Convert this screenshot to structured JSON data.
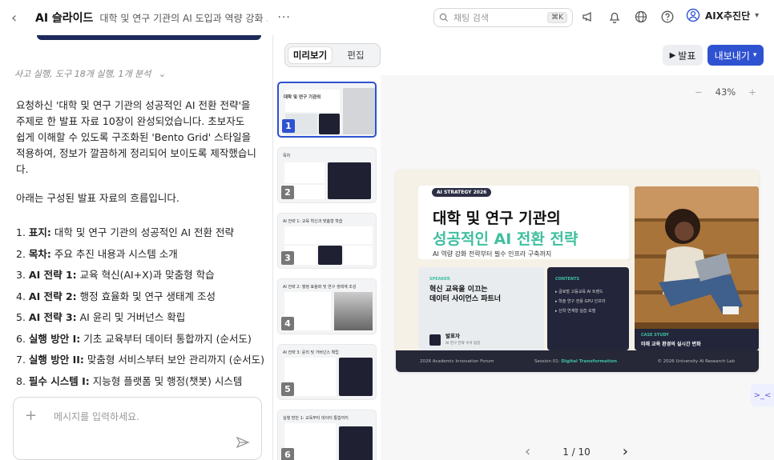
{
  "header": {
    "app_title": "AI 슬라이드",
    "doc_title": "대학 및 연구 기관의 AI 도입과 역량 강화 ...",
    "search_placeholder": "채팅 검색",
    "search_shortcut": "⌘K",
    "user_name": "AIX추진단"
  },
  "chat": {
    "thought_summary": "사고 실행, 도구 18개 실행, 1개 분석",
    "paragraph1": "요청하신 '대학 및 연구 기관의 성공적인 AI 전환 전략'을 주제로 한 발표 자료 10장이 완성되었습니다. 초보자도 쉽게 이해할 수 있도록 구조화된 'Bento Grid' 스타일을 적용하여, 정보가 깔끔하게 정리되어 보이도록 제작했습니다.",
    "paragraph2": "아래는 구성된 발표 자료의 흐름입니다.",
    "list": [
      {
        "num": "1.",
        "bold": "표지:",
        "text": " 대학 및 연구 기관의 성공적인 AI 전환 전략"
      },
      {
        "num": "2.",
        "bold": "목차:",
        "text": " 주요 추진 내용과 시스템 소개"
      },
      {
        "num": "3.",
        "bold": "AI 전략 1:",
        "text": " 교육 혁신(AI+X)과 맞춤형 학습"
      },
      {
        "num": "4.",
        "bold": "AI 전략 2:",
        "text": " 행정 효율화 및 연구 생태계 조성"
      },
      {
        "num": "5.",
        "bold": "AI 전략 3:",
        "text": " AI 윤리 및 거버넌스 확립"
      },
      {
        "num": "6.",
        "bold": "실행 방안 I:",
        "text": " 기초 교육부터 데이터 통합까지 (순서도)"
      },
      {
        "num": "7.",
        "bold": "실행 방안 II:",
        "text": " 맞춤형 서비스부터 보안 관리까지 (순서도)"
      },
      {
        "num": "8.",
        "bold": "필수 시스템 I:",
        "text": " 지능형 플랫폼 및 행정(챗봇) 시스템"
      }
    ],
    "composer_placeholder": "메시지를 입력하세요."
  },
  "toggle": {
    "preview": "미리보기",
    "edit": "편집"
  },
  "thumbnails": [
    {
      "num": "1",
      "title": "대학 및 연구 기관의"
    },
    {
      "num": "2",
      "title": "목차"
    },
    {
      "num": "3",
      "title": "AI 전략 1: 교육 혁신과 맞춤형 학습"
    },
    {
      "num": "4",
      "title": "AI 전략 2: 행정 효율화 및 연구 생태계 조성"
    },
    {
      "num": "5",
      "title": "AI 전략 3: 윤리 및 거버넌스 확립"
    },
    {
      "num": "6",
      "title": "실행 방안 1: 교육부터 데이터 통합까지"
    }
  ],
  "toolbar": {
    "present_label": "발표",
    "export_label": "내보내기",
    "zoom": "43%"
  },
  "slide": {
    "tag": "AI STRATEGY 2026",
    "title_line1": "대학 및 연구 기관의",
    "title_line2": "성공적인 AI 전환 전략",
    "subtitle": "AI 역량 강화 전략부터 필수 인프라 구축까지",
    "speaker_label": "SPEAKER",
    "speaker_title_line1": "혁신 교육을 이끄는",
    "speaker_title_line2": "데이터 사이언스 파트너",
    "speaker_name": "발표자",
    "speaker_role": "AI 연구 전략 수석 팀장",
    "contents_label": "CONTENTS",
    "contents": [
      "글로벌 고등교육 AI 트렌드",
      "학술 연구 전용 GPU 인프라",
      "산학 연계형 실습 모델"
    ],
    "case_label": "CASE STUDY",
    "case_text": "미래 교육 환경의 실시간 변화",
    "footer_left": "2026 Academic Innovation Forum",
    "footer_mid_prefix": "Session 01:",
    "footer_mid_highlight": "Digital Transformation",
    "footer_right": "© 2026 University AI Research Lab"
  },
  "pager": {
    "label": "1 / 10"
  },
  "colors": {
    "accent": "#2f52d1",
    "teal": "#3fbf9f",
    "dark": "#23253a"
  }
}
